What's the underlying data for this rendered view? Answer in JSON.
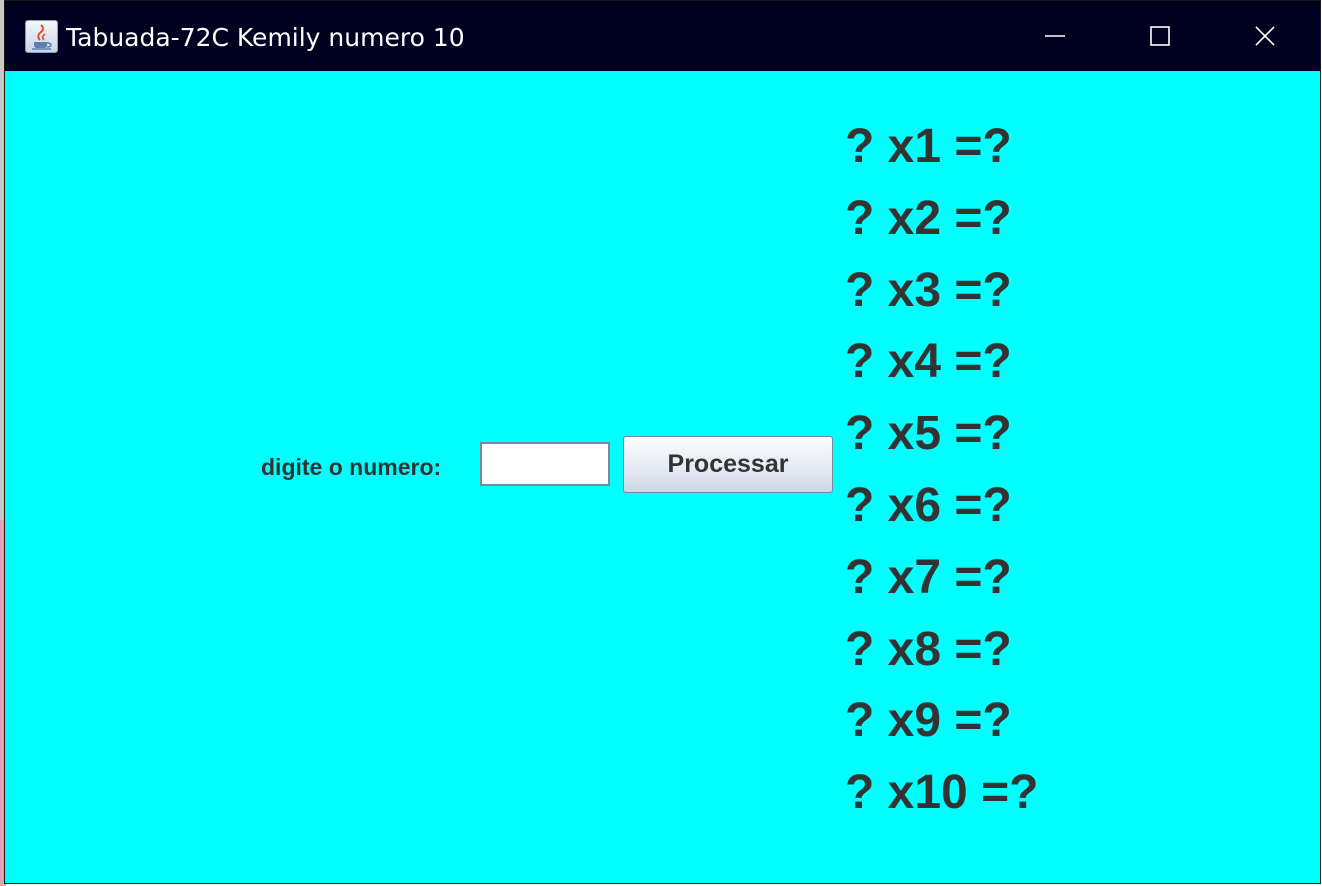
{
  "window": {
    "title": "Tabuada-72C Kemily numero 10",
    "icon": "java-coffee-icon",
    "controls": [
      "minimize-icon",
      "maximize-icon",
      "close-icon"
    ]
  },
  "form": {
    "prompt_label": "digite o numero:",
    "input_value": "",
    "button_label": "Processar"
  },
  "table_rows": [
    "? x1 =?",
    "? x2 =?",
    "? x3 =?",
    "? x4 =?",
    "? x5 =?",
    "? x6 =?",
    "? x7 =?",
    "? x8 =?",
    "? x9 =?",
    "? x10 =?"
  ],
  "colors": {
    "background": "#00ffff",
    "titlebar": "#000021",
    "text": "#333333"
  }
}
